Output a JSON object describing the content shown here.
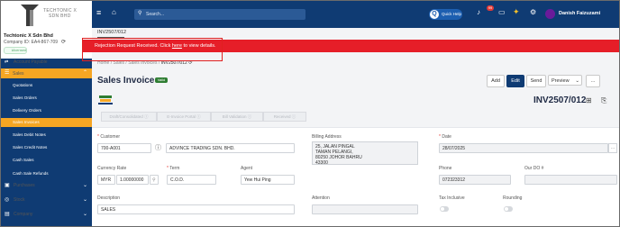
{
  "brand": {
    "name_line1": "TECHTONIC X",
    "name_line2": "SDN BHD"
  },
  "company": {
    "name": "Techtonic X Sdn Bhd",
    "id": "Company ID: EA4-867-709",
    "status": "Licensed"
  },
  "sidebar": {
    "top_item": "Account Payable",
    "sales": "Sales",
    "sales_subitems": [
      "Quotations",
      "Sales Orders",
      "Delivery Orders",
      "Sales Invoices",
      "Sales Debit Notes",
      "Sales Credit Notes",
      "Cash Sales",
      "Cash Sale Refunds"
    ],
    "other_items": [
      "Purchases",
      "Stock",
      "Company"
    ]
  },
  "topbar": {
    "search_placeholder": "Search...",
    "quick_label": "Quick Help",
    "notif_count": "99",
    "user_name": "Danish Faizuzami"
  },
  "doc_tab": "INV2507/012",
  "alert": {
    "text": "Rejection Request Received. Click ",
    "link": "here",
    "text_after": " to view details."
  },
  "breadcrumb": {
    "home": "Home",
    "sales": "Sales",
    "list": "Sales Invoices",
    "current": "INV2507/012"
  },
  "page": {
    "title": "Sales Invoice",
    "badge": "Valid",
    "doc_no": "INV2507/012"
  },
  "actions": {
    "add": "Add",
    "edit": "Edit",
    "send": "Send",
    "preview": "Preview",
    "more": "..."
  },
  "steps": [
    "Draft/Consolidated",
    "E-Invoice Portal",
    "Bill Validation",
    "Received"
  ],
  "form": {
    "customer_label": "Customer",
    "customer_code": "700-A001",
    "customer_name": "ADVINCE TRADING SDN. BHD.",
    "billing_label": "Billing Address",
    "billing_lines": [
      "25, JALAN PINGAL",
      "TAMAN PELANGI,",
      "80250 JOHOR BAHRU",
      "43300"
    ],
    "date_label": "Date",
    "date_value": "28/07/2025",
    "currency_label": "Currency Rate",
    "currency_code": "MYR",
    "currency_rate": "1.00000000",
    "term_label": "Term",
    "term_value": "C.O.D.",
    "agent_label": "Agent",
    "agent_value": "Yew Hui Ping",
    "phone_label": "Phone",
    "phone_value": "072323312",
    "our_do_label": "Our DO #",
    "description_label": "Description",
    "description_value": "SALES",
    "attention_label": "Attention",
    "tax_label": "Tax Inclusive",
    "rounding_label": "Rounding"
  },
  "colors": {
    "navy": "#0f3b73",
    "orange": "#f6a623",
    "alert_red": "#e61e28",
    "valid_green": "#2e7d32"
  }
}
